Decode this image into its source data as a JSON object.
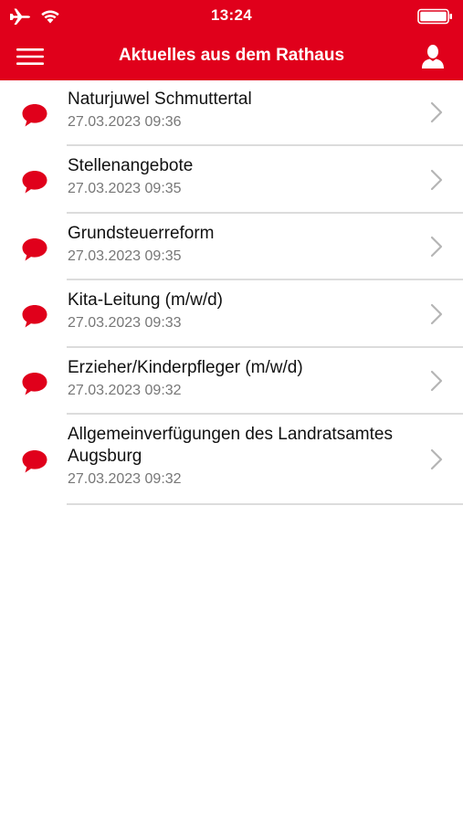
{
  "status_bar": {
    "time": "13:24",
    "icons": [
      "airplane-icon",
      "wifi-icon",
      "battery-icon"
    ]
  },
  "nav": {
    "title": "Aktuelles aus dem Rathaus",
    "menu_icon": "hamburger-menu-icon",
    "user_icon": "user-icon"
  },
  "colors": {
    "brand": "#e0001b",
    "title_text": "#111111",
    "date_text": "#777777",
    "separator": "#dcdcdc"
  },
  "news": [
    {
      "title": "Naturjuwel Schmuttertal",
      "date": "27.03.2023 09:36"
    },
    {
      "title": "Stellenangebote",
      "date": "27.03.2023 09:35"
    },
    {
      "title": "Grundsteuerreform",
      "date": "27.03.2023 09:35"
    },
    {
      "title": "Kita-Leitung (m/w/d)",
      "date": "27.03.2023 09:33"
    },
    {
      "title": "Erzieher/Kinderpfleger (m/w/d)",
      "date": "27.03.2023 09:32"
    },
    {
      "title": "Allgemeinverfügungen des Landratsamtes Augsburg",
      "date": "27.03.2023 09:32"
    }
  ]
}
